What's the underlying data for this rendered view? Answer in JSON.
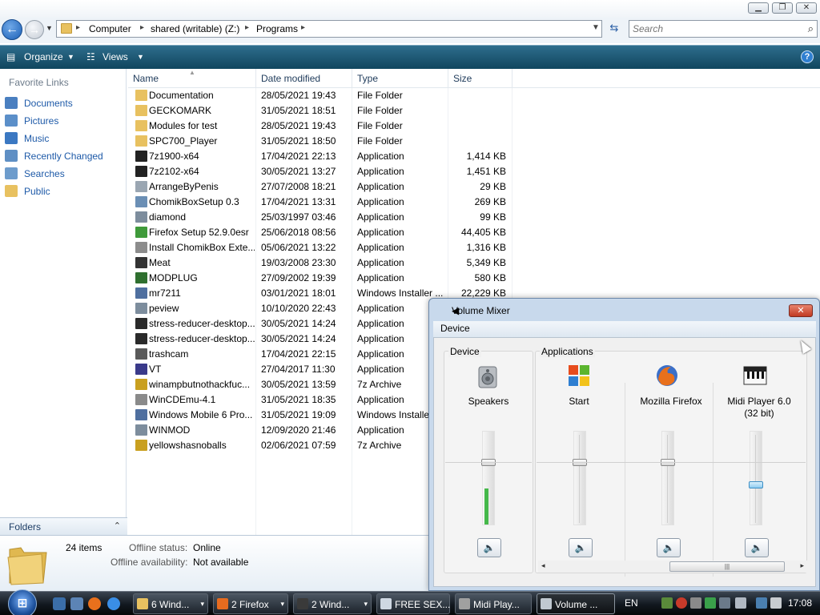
{
  "window": {
    "min_glyph": "▁",
    "max_glyph": "❐",
    "close_glyph": "✕"
  },
  "address": {
    "crumbs": [
      "Computer",
      "shared (writable) (Z:)",
      "Programs"
    ],
    "search_placeholder": "Search"
  },
  "toolbar": {
    "organize_label": "Organize",
    "views_label": "Views",
    "help_glyph": "?"
  },
  "nav": {
    "favorites_heading": "Favorite Links",
    "links": [
      {
        "label": "Documents",
        "icon": "documents-icon",
        "color": "#4a7fc0"
      },
      {
        "label": "Pictures",
        "icon": "pictures-icon",
        "color": "#5b8fc9"
      },
      {
        "label": "Music",
        "icon": "music-icon",
        "color": "#3b78c2"
      },
      {
        "label": "Recently Changed",
        "icon": "recent-icon",
        "color": "#5f8fc4"
      },
      {
        "label": "Searches",
        "icon": "searches-icon",
        "color": "#6d9ccc"
      },
      {
        "label": "Public",
        "icon": "public-folder-icon",
        "color": "#e8c160"
      }
    ],
    "folders_label": "Folders",
    "folders_chevron": "⌃"
  },
  "columns": {
    "name": "Name",
    "date": "Date modified",
    "type": "Type",
    "size": "Size"
  },
  "files": [
    {
      "name": "Documentation",
      "date": "28/05/2021 19:43",
      "type": "File Folder",
      "size": "",
      "icon": "#e8c160"
    },
    {
      "name": "GECKOMARK",
      "date": "31/05/2021 18:51",
      "type": "File Folder",
      "size": "",
      "icon": "#e8c160"
    },
    {
      "name": "Modules for test",
      "date": "28/05/2021 19:43",
      "type": "File Folder",
      "size": "",
      "icon": "#e8c160"
    },
    {
      "name": "SPC700_Player",
      "date": "31/05/2021 18:50",
      "type": "File Folder",
      "size": "",
      "icon": "#e8c160"
    },
    {
      "name": "7z1900-x64",
      "date": "17/04/2021 22:13",
      "type": "Application",
      "size": "1,414 KB",
      "icon": "#222222"
    },
    {
      "name": "7z2102-x64",
      "date": "30/05/2021 13:27",
      "type": "Application",
      "size": "1,451 KB",
      "icon": "#222222"
    },
    {
      "name": "ArrangeByPenis",
      "date": "27/07/2008 18:21",
      "type": "Application",
      "size": "29 KB",
      "icon": "#9aa6b2"
    },
    {
      "name": "ChomikBoxSetup 0.3",
      "date": "17/04/2021 13:31",
      "type": "Application",
      "size": "269 KB",
      "icon": "#6b8fb5"
    },
    {
      "name": "diamond",
      "date": "25/03/1997 03:46",
      "type": "Application",
      "size": "99 KB",
      "icon": "#7d8d9d"
    },
    {
      "name": "Firefox Setup 52.9.0esr",
      "date": "25/06/2018 08:56",
      "type": "Application",
      "size": "44,405 KB",
      "icon": "#3f9a3a"
    },
    {
      "name": "Install ChomikBox Exte...",
      "date": "05/06/2021 13:22",
      "type": "Application",
      "size": "1,316 KB",
      "icon": "#8c8c8c"
    },
    {
      "name": "Meat",
      "date": "19/03/2008 23:30",
      "type": "Application",
      "size": "5,349 KB",
      "icon": "#333333"
    },
    {
      "name": "MODPLUG",
      "date": "27/09/2002 19:39",
      "type": "Application",
      "size": "580 KB",
      "icon": "#2f6f2f"
    },
    {
      "name": "mr7211",
      "date": "03/01/2021 18:01",
      "type": "Windows Installer ...",
      "size": "22,229 KB",
      "icon": "#4f6f9f"
    },
    {
      "name": "peview",
      "date": "10/10/2020 22:43",
      "type": "Application",
      "size": "",
      "icon": "#7d8d9d"
    },
    {
      "name": "stress-reducer-desktop...",
      "date": "30/05/2021 14:24",
      "type": "Application",
      "size": "",
      "icon": "#2a2a2a"
    },
    {
      "name": "stress-reducer-desktop...",
      "date": "30/05/2021 14:24",
      "type": "Application",
      "size": "",
      "icon": "#2a2a2a"
    },
    {
      "name": "trashcam",
      "date": "17/04/2021 22:15",
      "type": "Application",
      "size": "",
      "icon": "#5a5a5a"
    },
    {
      "name": "VT",
      "date": "27/04/2017 11:30",
      "type": "Application",
      "size": "",
      "icon": "#3a3a8a"
    },
    {
      "name": "winampbutnothackfuc...",
      "date": "30/05/2021 13:59",
      "type": "7z Archive",
      "size": "",
      "icon": "#c9a020"
    },
    {
      "name": "WinCDEmu-4.1",
      "date": "31/05/2021 18:35",
      "type": "Application",
      "size": "",
      "icon": "#8a8a8a"
    },
    {
      "name": "Windows Mobile 6 Pro...",
      "date": "31/05/2021 19:09",
      "type": "Windows Installe",
      "size": "",
      "icon": "#4f6f9f"
    },
    {
      "name": "WINMOD",
      "date": "12/09/2020 21:46",
      "type": "Application",
      "size": "",
      "icon": "#7d8d9d"
    },
    {
      "name": "yellowshasnoballs",
      "date": "02/06/2021 07:59",
      "type": "7z Archive",
      "size": "",
      "icon": "#c9a020"
    }
  ],
  "details": {
    "item_count": "24 items",
    "offline_status_label": "Offline status:",
    "offline_status_value": "Online",
    "offline_avail_label": "Offline availability:",
    "offline_avail_value": "Not available"
  },
  "mixer": {
    "title": "Volume Mixer",
    "close_glyph": "✕",
    "menu_device": "Device",
    "device_group": "Device",
    "apps_group": "Applications",
    "speakers_label": "Speakers",
    "speakers_level": 0.68,
    "speakers_meter": 0.38,
    "apps": [
      {
        "label": "Start",
        "level": 0.68
      },
      {
        "label": "Mozilla Firefox",
        "level": 0.68
      },
      {
        "label": "Midi Player 6.0",
        "sublabel": "(32 bit)",
        "level": 0.42
      }
    ],
    "mute_glyph": "🔈",
    "scroll_left": "◂",
    "scroll_right": "▸",
    "scroll_grip": "|||"
  },
  "taskbar": {
    "start_glyph": "⊞",
    "tasks": [
      {
        "label": "6 Wind...",
        "icon": "#e8c160",
        "dropdown": true
      },
      {
        "label": "2 Firefox",
        "icon": "#e66b1f",
        "dropdown": true
      },
      {
        "label": "2 Wind...",
        "icon": "#3a3a3a",
        "dropdown": true
      },
      {
        "label": "FREE SEX...",
        "icon": "#cfd8e2",
        "dropdown": false
      },
      {
        "label": "Midi Play...",
        "icon": "#a0a0a0",
        "dropdown": false
      },
      {
        "label": "Volume ...",
        "icon": "#c0c8d0",
        "dropdown": false
      }
    ],
    "dropdown_glyph": "▾",
    "language": "EN",
    "clock": "17:08"
  }
}
